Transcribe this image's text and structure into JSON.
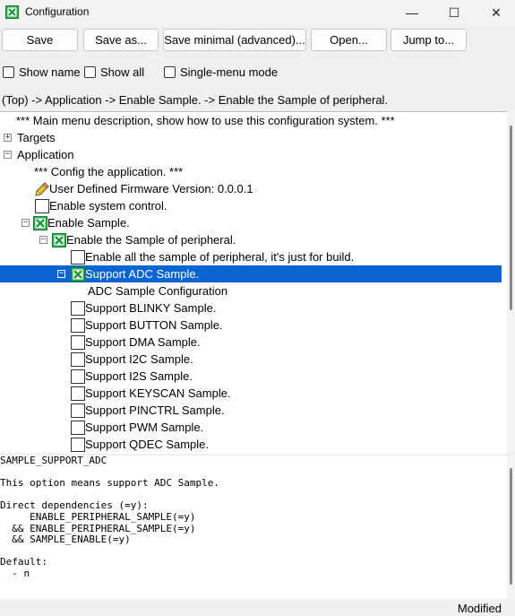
{
  "window": {
    "title": "Configuration",
    "app_icon": "green-x-checkbox-icon",
    "minimize_glyph": "—",
    "maximize_glyph": "☐",
    "close_glyph": "✕"
  },
  "toolbar": {
    "save": "Save",
    "save_as": "Save as...",
    "save_minimal": "Save minimal (advanced)...",
    "open": "Open...",
    "jump_to": "Jump to..."
  },
  "options": {
    "show_name": "Show name",
    "show_all": "Show all",
    "single_menu": "Single-menu mode"
  },
  "breadcrumb": "(Top) -> Application -> Enable Sample. -> Enable the Sample of peripheral.",
  "tree": {
    "main_desc": "*** Main menu description, show how to use this configuration system. ***",
    "targets": "Targets",
    "application": "Application",
    "config_app": "*** Config the application. ***",
    "firmware_version": "User Defined Firmware Version: 0.0.0.1",
    "enable_system_control": "Enable system control.",
    "enable_sample": "Enable Sample.",
    "enable_peripheral_sample": "Enable the Sample of peripheral.",
    "enable_all": "Enable all the sample of peripheral, it's just for build.",
    "support_adc": "Support ADC Sample.",
    "adc_config": "ADC Sample Configuration",
    "blinky": "Support BLINKY Sample.",
    "button": "Support BUTTON Sample.",
    "dma": "Support DMA Sample.",
    "i2c": "Support I2C Sample.",
    "i2s": "Support I2S Sample.",
    "keyscan": "Support KEYSCAN Sample.",
    "pinctrl": "Support PINCTRL Sample.",
    "pwm": "Support PWM Sample.",
    "qdec": "Support QDEC Sample."
  },
  "info": {
    "line1": "SAMPLE_SUPPORT_ADC",
    "line2": "",
    "line3": "This option means support ADC Sample.",
    "line4": "",
    "line5": "Direct dependencies (=y):",
    "line6": "     ENABLE_PERIPHERAL_SAMPLE(=y)",
    "line7": "  && ENABLE_PERIPHERAL_SAMPLE(=y)",
    "line8": "  && SAMPLE_ENABLE(=y)",
    "line9": "",
    "line10": "Default:",
    "line11": "  - n"
  },
  "status": "Modified"
}
